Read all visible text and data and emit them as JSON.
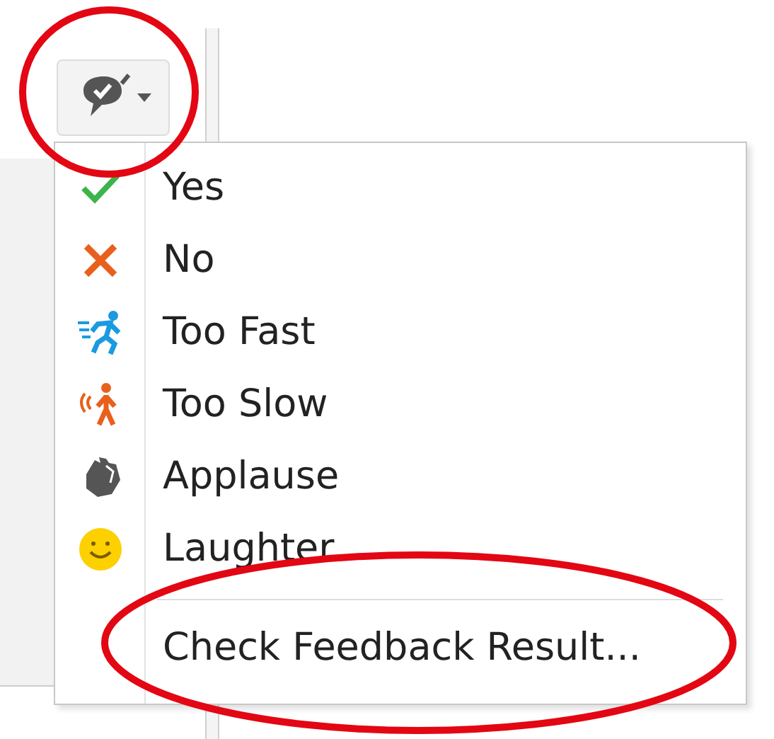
{
  "toolbar": {
    "feedback_button": {
      "expanded": true
    }
  },
  "menu": {
    "groups": [
      [
        {
          "label": "Yes"
        },
        {
          "label": "No"
        },
        {
          "label": "Too Fast"
        },
        {
          "label": "Too Slow"
        },
        {
          "label": "Applause"
        },
        {
          "label": "Laughter"
        }
      ],
      [
        {
          "label": "Check Feedback Result..."
        }
      ]
    ]
  }
}
